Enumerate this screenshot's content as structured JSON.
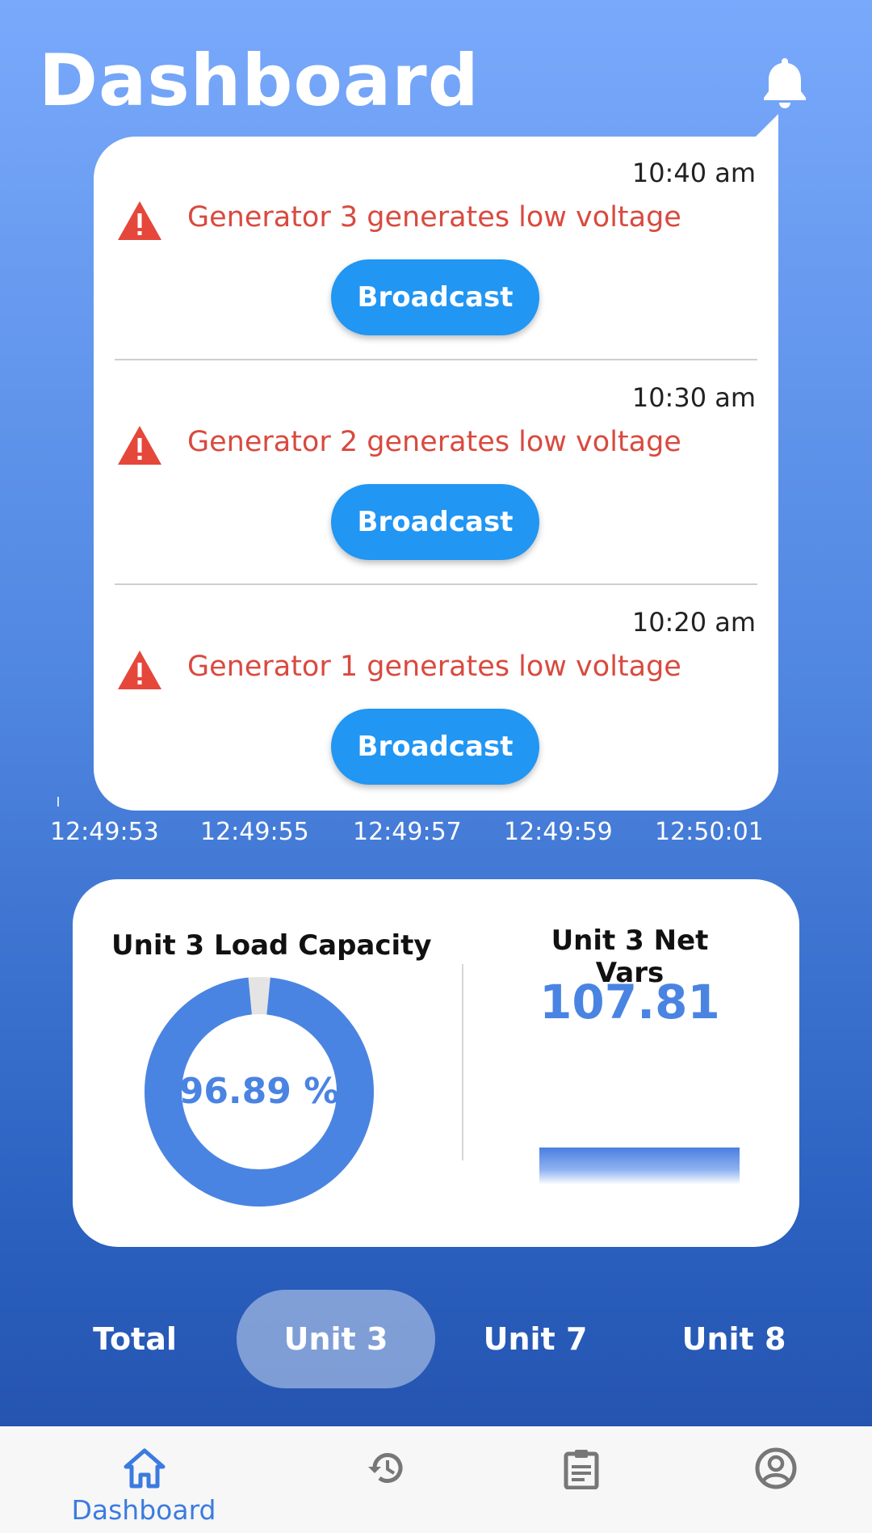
{
  "header": {
    "title": "Dashboard"
  },
  "notifications": [
    {
      "time": "10:40 am",
      "message": "Generator 3 generates low voltage",
      "action_label": "Broadcast"
    },
    {
      "time": "10:30 am",
      "message": "Generator 2 generates low voltage",
      "action_label": "Broadcast"
    },
    {
      "time": "10:20 am",
      "message": "Generator 1 generates low voltage",
      "action_label": "Broadcast"
    }
  ],
  "chart_axis": {
    "labels": [
      "12:49:53",
      "12:49:55",
      "12:49:57",
      "12:49:59",
      "12:50:01"
    ]
  },
  "load_capacity": {
    "title": "Unit 3 Load Capacity",
    "value_text": "96.89 %",
    "percent": 96.89
  },
  "net_vars": {
    "title": "Unit 3 Net Vars",
    "value": "107.81"
  },
  "unit_tabs": [
    {
      "label": "Total",
      "active": false
    },
    {
      "label": "Unit 3",
      "active": true
    },
    {
      "label": "Unit 7",
      "active": false
    },
    {
      "label": "Unit 8",
      "active": false
    }
  ],
  "bottom_nav": {
    "dashboard_label": "Dashboard"
  },
  "colors": {
    "accent": "#4a84e2",
    "alert": "#d94a3f",
    "button": "#2196f3",
    "track": "#e4e4e4"
  }
}
